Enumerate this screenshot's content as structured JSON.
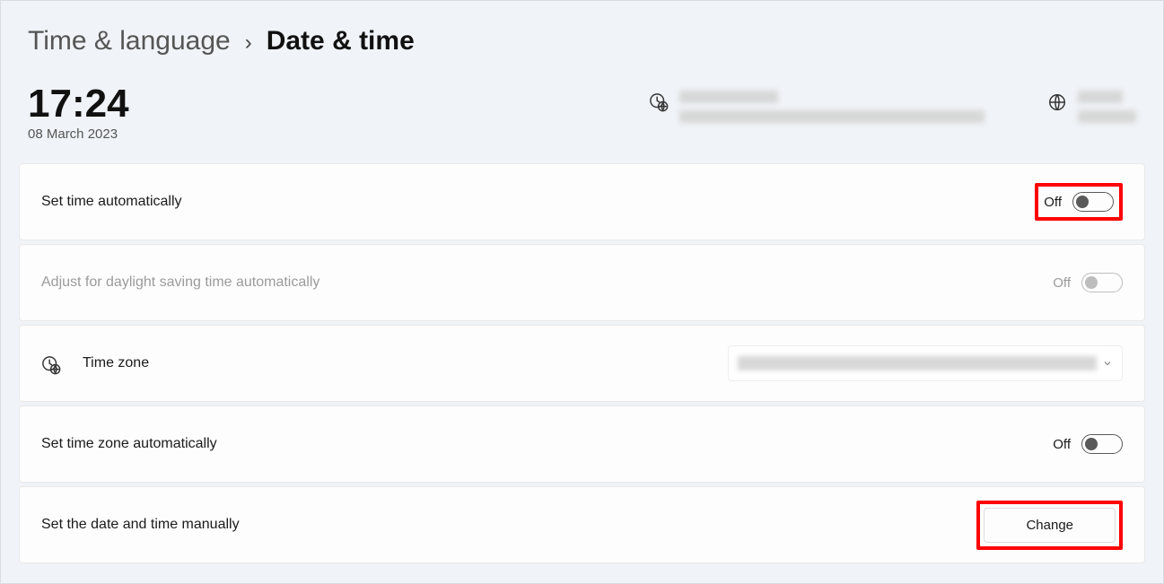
{
  "breadcrumb": {
    "parent": "Time & language",
    "separator": "›",
    "current": "Date & time"
  },
  "clock": {
    "time": "17:24",
    "date": "08 March 2023"
  },
  "rows": {
    "set_time_auto": {
      "label": "Set time automatically",
      "state": "Off"
    },
    "dst_auto": {
      "label": "Adjust for daylight saving time automatically",
      "state": "Off"
    },
    "time_zone": {
      "label": "Time zone"
    },
    "set_tz_auto": {
      "label": "Set time zone automatically",
      "state": "Off"
    },
    "manual": {
      "label": "Set the date and time manually",
      "button": "Change"
    }
  }
}
